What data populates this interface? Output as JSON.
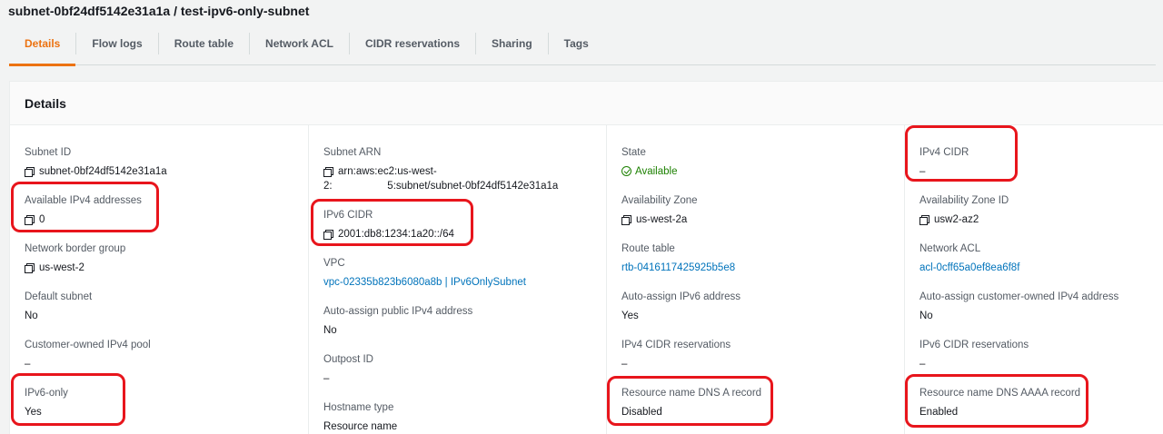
{
  "page": {
    "title": "subnet-0bf24df5142e31a1a / test-ipv6-only-subnet"
  },
  "tabs": [
    {
      "label": "Details",
      "active": true
    },
    {
      "label": "Flow logs"
    },
    {
      "label": "Route table"
    },
    {
      "label": "Network ACL"
    },
    {
      "label": "CIDR reservations"
    },
    {
      "label": "Sharing"
    },
    {
      "label": "Tags"
    }
  ],
  "panel": {
    "title": "Details"
  },
  "col1": {
    "subnet_id": {
      "label": "Subnet ID",
      "value": "subnet-0bf24df5142e31a1a"
    },
    "available_ipv4": {
      "label": "Available IPv4 addresses",
      "value": "0"
    },
    "border_group": {
      "label": "Network border group",
      "value": "us-west-2"
    },
    "default_subnet": {
      "label": "Default subnet",
      "value": "No"
    },
    "customer_pool": {
      "label": "Customer-owned IPv4 pool",
      "value": "–"
    },
    "ipv6_only": {
      "label": "IPv6-only",
      "value": "Yes"
    }
  },
  "col2": {
    "subnet_arn": {
      "label": "Subnet ARN",
      "line1": "arn:aws:ec2:us-west-",
      "line2": "2:                   5:subnet/subnet-0bf24df5142e31a1a"
    },
    "ipv6_cidr": {
      "label": "IPv6 CIDR",
      "value": "2001:db8:1234:1a20::/64"
    },
    "vpc": {
      "label": "VPC",
      "value": "vpc-02335b823b6080a8b | IPv6OnlySubnet"
    },
    "auto_public_ipv4": {
      "label": "Auto-assign public IPv4 address",
      "value": "No"
    },
    "outpost_id": {
      "label": "Outpost ID",
      "value": "–"
    },
    "hostname_type": {
      "label": "Hostname type",
      "value": "Resource name"
    }
  },
  "col3": {
    "state": {
      "label": "State",
      "value": "Available"
    },
    "az": {
      "label": "Availability Zone",
      "value": "us-west-2a"
    },
    "route_table": {
      "label": "Route table",
      "value": "rtb-0416117425925b5e8"
    },
    "auto_ipv6": {
      "label": "Auto-assign IPv6 address",
      "value": "Yes"
    },
    "ipv4_reservations": {
      "label": "IPv4 CIDR reservations",
      "value": "–"
    },
    "dns_a": {
      "label": "Resource name DNS A record",
      "value": "Disabled"
    }
  },
  "col4": {
    "ipv4_cidr": {
      "label": "IPv4 CIDR",
      "value": "–"
    },
    "az_id": {
      "label": "Availability Zone ID",
      "value": "usw2-az2"
    },
    "network_acl": {
      "label": "Network ACL",
      "value": "acl-0cff65a0ef8ea6f8f"
    },
    "auto_customer_ipv4": {
      "label": "Auto-assign customer-owned IPv4 address",
      "value": "No"
    },
    "ipv6_reservations": {
      "label": "IPv6 CIDR reservations",
      "value": "–"
    },
    "dns_aaaa": {
      "label": "Resource name DNS AAAA record",
      "value": "Enabled"
    }
  },
  "icons": {
    "copy": "copy-icon",
    "status": "check-circle-icon"
  },
  "colors": {
    "accent": "#ec7211",
    "link": "#0073bb",
    "success": "#1d8102",
    "highlight": "#e8151c"
  }
}
